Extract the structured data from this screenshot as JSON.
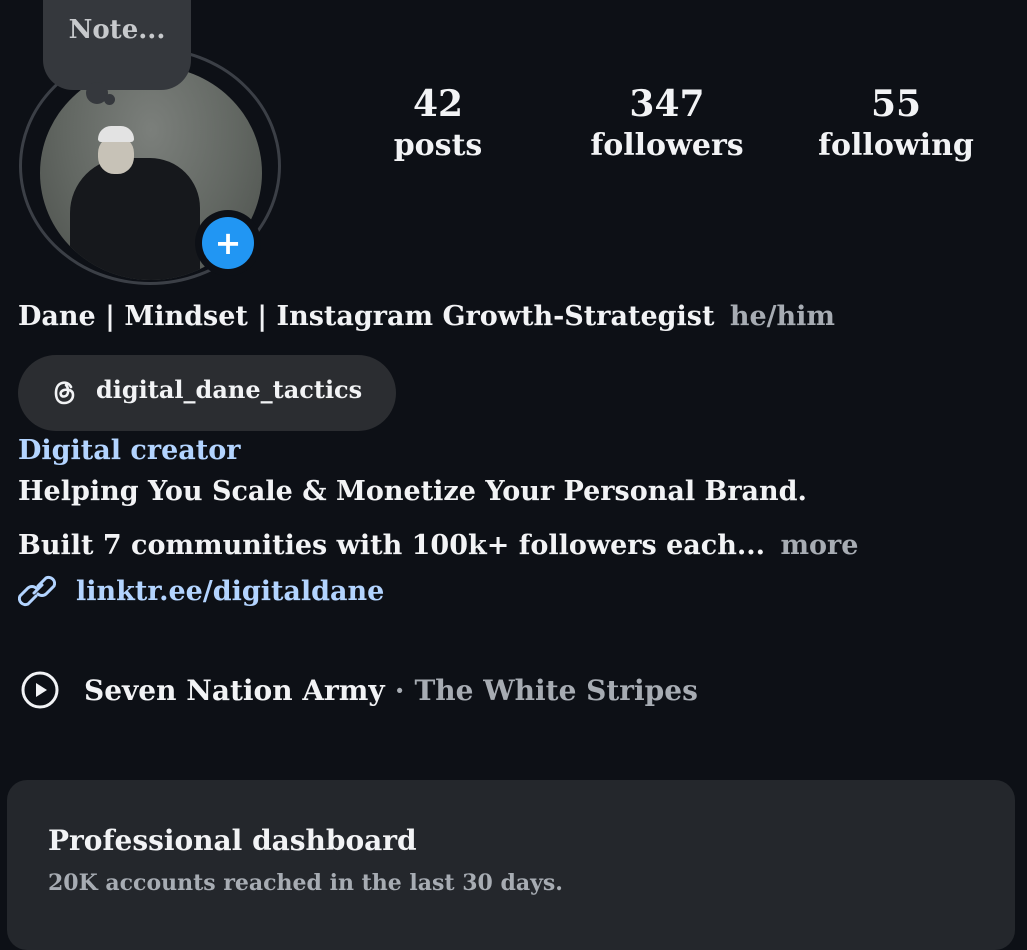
{
  "profile": {
    "note": "Note...",
    "stats": [
      {
        "value": "42",
        "label": "posts"
      },
      {
        "value": "347",
        "label": "followers"
      },
      {
        "value": "55",
        "label": "following"
      }
    ],
    "name": "Dane | Mindset | Instagram Growth-Strategist",
    "pronouns": "he/him",
    "threads_handle": "digital_dane_tactics",
    "category": "Digital creator",
    "bio_line1": "Helping You Scale & Monetize Your Personal Brand.",
    "bio_line2": "Built 7 communities with 100k+ followers each...",
    "more": "more",
    "link": "linktr.ee/digitaldane",
    "music_song": "Seven Nation Army",
    "music_separator": "·",
    "music_artist": "The White Stripes"
  },
  "dashboard": {
    "title": "Professional dashboard",
    "subtitle": "20K accounts reached in the last 30 days."
  },
  "colors": {
    "background": "#0d1016",
    "link_blue": "#b3d4ff",
    "add_button": "#2196f3",
    "muted": "#a7acb3"
  },
  "icons": {
    "add": "plus-icon",
    "threads": "threads-icon",
    "link": "link-icon",
    "music": "play-circle-icon"
  }
}
